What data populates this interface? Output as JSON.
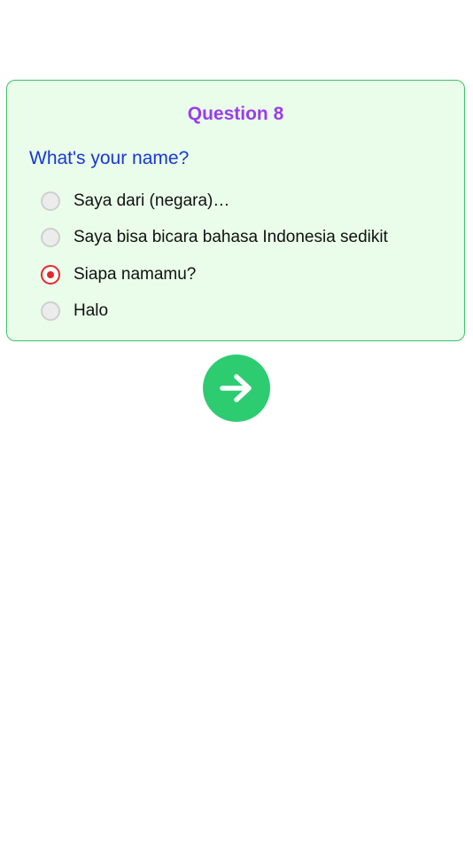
{
  "quiz": {
    "question_title": "Question 8",
    "question_text": "What's your name?",
    "options": [
      {
        "label": "Saya dari (negara)…",
        "selected": false
      },
      {
        "label": "Saya bisa bicara bahasa Indonesia sedikit",
        "selected": false
      },
      {
        "label": "Siapa namamu?",
        "selected": true
      },
      {
        "label": "Halo",
        "selected": false
      }
    ]
  },
  "next_button": {
    "icon": "arrow-right-icon"
  },
  "colors": {
    "title": "#9a3cf0",
    "question": "#1538d8",
    "card_background": "#eafdea",
    "card_border": "#3cc46a",
    "selected_radio": "#e62828",
    "next_button": "#2ecc71"
  }
}
